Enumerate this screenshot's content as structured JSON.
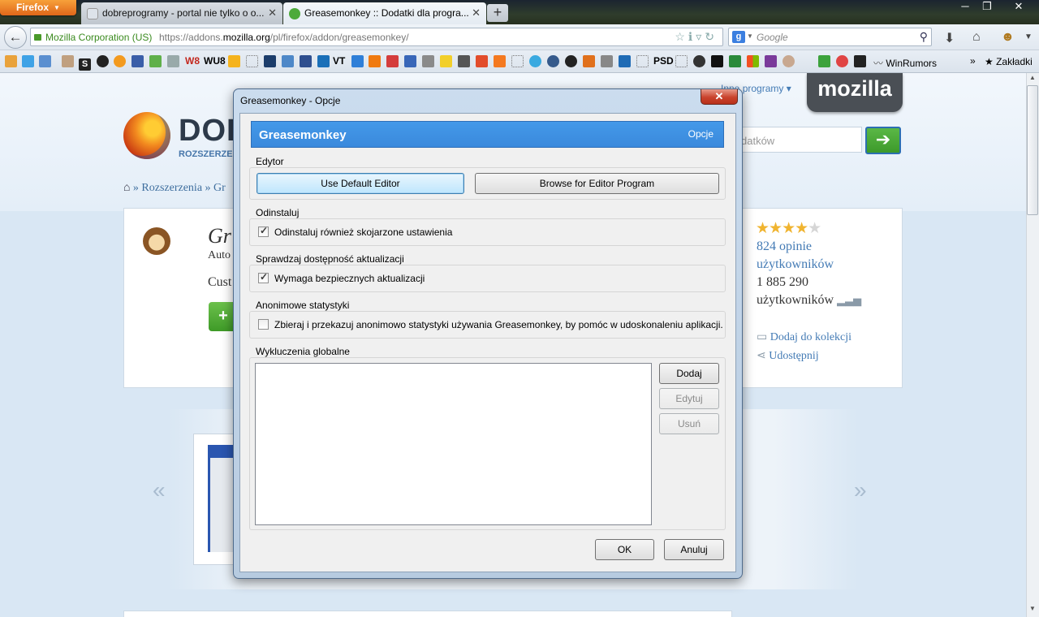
{
  "browser": {
    "app_button": "Firefox",
    "tabs": [
      {
        "title": "dobreprogramy - portal nie tylko o o...",
        "active": false
      },
      {
        "title": "Greasemonkey :: Dodatki dla progra...",
        "active": true
      }
    ],
    "new_tab": "+",
    "window_controls": [
      "─",
      "❐",
      "✕"
    ],
    "identity": "Mozilla Corporation (US)",
    "url_prefix": "https://addons.",
    "url_host": "mozilla.org",
    "url_path": "/pl/firefox/addon/greasemonkey/",
    "search_placeholder": "Google",
    "search_engine_letter": "g"
  },
  "bookmarks": {
    "items": [
      "S",
      "W8",
      "WU8",
      "VT",
      "PSD"
    ],
    "winrumors": "WinRumors",
    "more": "»",
    "zakladki": "Zakładki"
  },
  "page": {
    "mozilla": "mozilla",
    "other_programs": "Inne programy ▾",
    "title": "DOD",
    "subtitle": "ROZSZERZEN",
    "search_placeholder": "datków",
    "breadcrumb": "» Rozszerzenia » Gr",
    "addon_name": "Gr",
    "addon_author": "Auto",
    "addon_summary": "Cust",
    "install": "+",
    "rating_stars": "★★★★",
    "rating_off": "★",
    "reviews_line1": "824 opinie",
    "reviews_line2": "użytkowników",
    "users_count": "1 885 290",
    "users_label": "użytkowników",
    "add_to_collection": "Dodaj do kolekcji",
    "share": "Udostępnij",
    "prev": "«",
    "next": "»"
  },
  "dialog": {
    "window_title": "Greasemonkey - Opcje",
    "close": "✕",
    "header_title": "Greasemonkey",
    "header_pane": "Opcje",
    "editor": {
      "label": "Edytor",
      "use_default": "Use Default Editor",
      "browse": "Browse for Editor Program"
    },
    "uninstall": {
      "label": "Odinstaluj",
      "checkbox": "Odinstaluj również skojarzone ustawienia",
      "checked": true
    },
    "updates": {
      "label": "Sprawdzaj dostępność aktualizacji",
      "checkbox": "Wymaga bezpiecznych aktualizacji",
      "checked": true
    },
    "stats": {
      "label": "Anonimowe statystyki",
      "checkbox": "Zbieraj i przekazuj anonimowo statystyki używania Greasemonkey, by pomóc w udoskonaleniu aplikacji.",
      "checked": false
    },
    "exclusions": {
      "label": "Wykluczenia globalne",
      "add": "Dodaj",
      "edit": "Edytuj",
      "remove": "Usuń"
    },
    "ok": "OK",
    "cancel": "Anuluj"
  }
}
